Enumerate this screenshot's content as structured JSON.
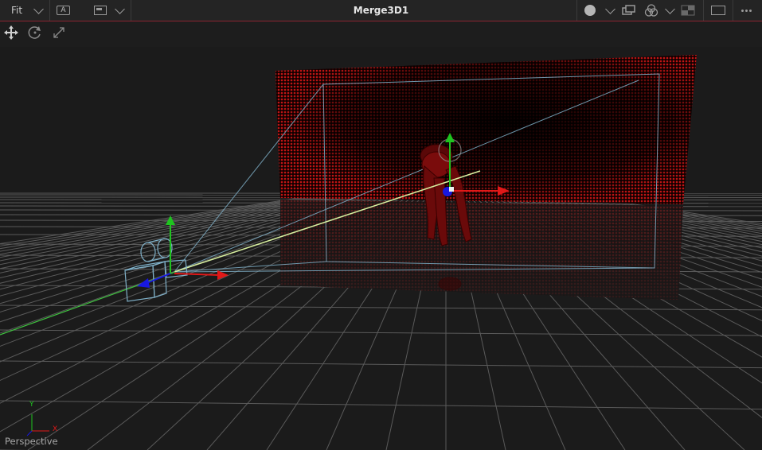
{
  "topbar": {
    "zoom_label": "Fit",
    "channel_button_label": "A",
    "title": "Merge3D1"
  },
  "viewport": {
    "view_label": "Perspective",
    "axis_y_label": "Y",
    "axis_x_label": "X"
  },
  "colors": {
    "accent": "#8a2430",
    "x_axis": "#e01818",
    "y_axis": "#1fc41f",
    "z_axis": "#1818e0",
    "camera_wire": "#7fb0c8",
    "backdrop": "#b01010"
  },
  "icons": {
    "toolbar": [
      "move-icon",
      "rotate-icon",
      "scale-icon"
    ],
    "topbar_right": [
      "circle-icon",
      "stacked-rect-icon",
      "rgb-circles-icon",
      "checker-icon",
      "rect-icon",
      "more-icon"
    ]
  }
}
